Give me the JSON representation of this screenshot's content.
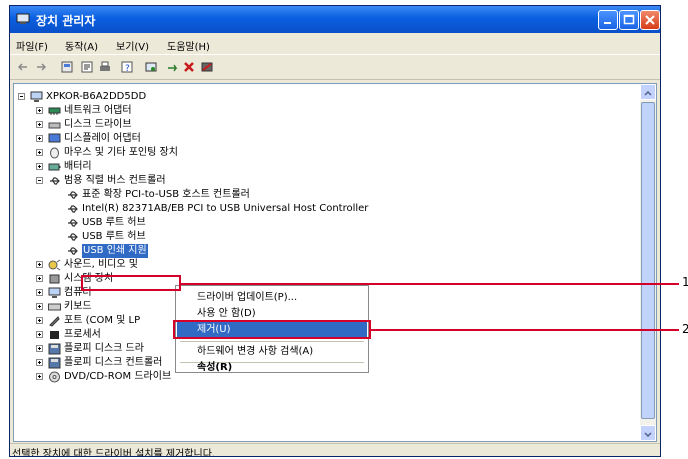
{
  "window": {
    "title": "장치 관리자"
  },
  "menus": [
    "파일(F)",
    "동작(A)",
    "보기(V)",
    "도움말(H)"
  ],
  "tree": [
    {
      "label": "XPKOR-B6A2DD5DD",
      "level": 0,
      "expander": "minus",
      "icon": "computer-icon"
    },
    {
      "label": "네트워크 어댑터",
      "level": 1,
      "expander": "plus",
      "icon": "network-adapter-icon"
    },
    {
      "label": "디스크 드라이브",
      "level": 1,
      "expander": "plus",
      "icon": "disk-drive-icon"
    },
    {
      "label": "디스플레이 어댑터",
      "level": 1,
      "expander": "plus",
      "icon": "display-adapter-icon"
    },
    {
      "label": "마우스 및 기타 포인팅 장치",
      "level": 1,
      "expander": "plus",
      "icon": "mouse-icon"
    },
    {
      "label": "배터리",
      "level": 1,
      "expander": "plus",
      "icon": "battery-icon"
    },
    {
      "label": "범용 직렬 버스 컨트롤러",
      "level": 1,
      "expander": "minus",
      "icon": "usb-icon"
    },
    {
      "label": "표준 확장 PCI-to-USB 호스트 컨트롤러",
      "level": 2,
      "expander": "none",
      "icon": "usb-icon"
    },
    {
      "label": "Intel(R) 82371AB/EB PCI to USB Universal Host Controller",
      "level": 2,
      "expander": "none",
      "icon": "usb-icon"
    },
    {
      "label": "USB 루트 허브",
      "level": 2,
      "expander": "none",
      "icon": "usb-icon"
    },
    {
      "label": "USB 루트 허브",
      "level": 2,
      "expander": "none",
      "icon": "usb-icon"
    },
    {
      "label": "USB 인쇄 지원",
      "level": 2,
      "expander": "none",
      "icon": "usb-icon",
      "selected": true
    },
    {
      "label": "사운드, 비디오 및",
      "level": 1,
      "expander": "plus",
      "icon": "sound-icon"
    },
    {
      "label": "시스템 장치",
      "level": 1,
      "expander": "plus",
      "icon": "system-device-icon"
    },
    {
      "label": "컴퓨터",
      "level": 1,
      "expander": "plus",
      "icon": "computer-icon"
    },
    {
      "label": "키보드",
      "level": 1,
      "expander": "plus",
      "icon": "keyboard-icon"
    },
    {
      "label": "포트 (COM 및 LP",
      "level": 1,
      "expander": "plus",
      "icon": "port-icon"
    },
    {
      "label": "프로세서",
      "level": 1,
      "expander": "plus",
      "icon": "processor-icon"
    },
    {
      "label": "플로피 디스크 드라",
      "level": 1,
      "expander": "plus",
      "icon": "floppy-icon"
    },
    {
      "label": "플로피 디스크 컨트롤러",
      "level": 1,
      "expander": "plus",
      "icon": "floppy-controller-icon"
    },
    {
      "label": "DVD/CD-ROM 드라이브",
      "level": 1,
      "expander": "plus",
      "icon": "cdrom-icon"
    }
  ],
  "context_menu": [
    {
      "label": "드라이버 업데이트(P)...",
      "highlighted": false
    },
    {
      "label": "사용 안 함(D)",
      "highlighted": false
    },
    {
      "label": "제거(U)",
      "highlighted": true
    },
    {
      "label": "하드웨어 변경 사항 검색(A)",
      "highlighted": false,
      "separator_before": true
    },
    {
      "label": "속성(R)",
      "highlighted": false,
      "bold": true,
      "separator_before": true
    }
  ],
  "status_text": "선택한 장치에 대한 드라이버 설치를 제거합니다.",
  "callouts": [
    "1",
    "2"
  ],
  "colors": {
    "titlebar": "#0a5fe0",
    "selection": "#316ac5",
    "highlight_box": "#d4002a",
    "chrome": "#ece9d8"
  }
}
